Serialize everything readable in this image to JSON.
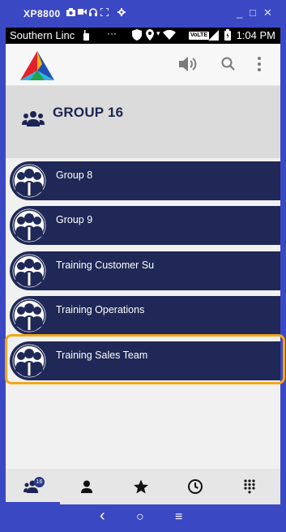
{
  "emulator": {
    "title": "XP8800",
    "window_minimize": "_",
    "window_maximize": "□",
    "window_close": "✕"
  },
  "status_bar": {
    "carrier": "Southern Linc",
    "volte": "VoLTE",
    "time": "1:04 PM"
  },
  "header": {
    "title": "GROUP 16"
  },
  "groups": [
    {
      "label": "Group 8"
    },
    {
      "label": "Group 9"
    },
    {
      "label": "Training Customer Su"
    },
    {
      "label": "Training Operations"
    },
    {
      "label": "Training Sales Team",
      "highlighted": true
    }
  ],
  "tabs": [
    {
      "name": "groups",
      "icon": "groups-icon",
      "badge": "16",
      "active": true
    },
    {
      "name": "contacts",
      "icon": "person-icon"
    },
    {
      "name": "favorites",
      "icon": "star-icon"
    },
    {
      "name": "history",
      "icon": "clock-icon"
    },
    {
      "name": "dialpad",
      "icon": "dialpad-icon"
    }
  ],
  "nav": {
    "back": "‹",
    "home": "○",
    "menu": "≡"
  },
  "colors": {
    "brand": "#3b48c4",
    "row": "#1f2856",
    "highlight": "#f3a61a",
    "header_text": "#1c2454"
  }
}
